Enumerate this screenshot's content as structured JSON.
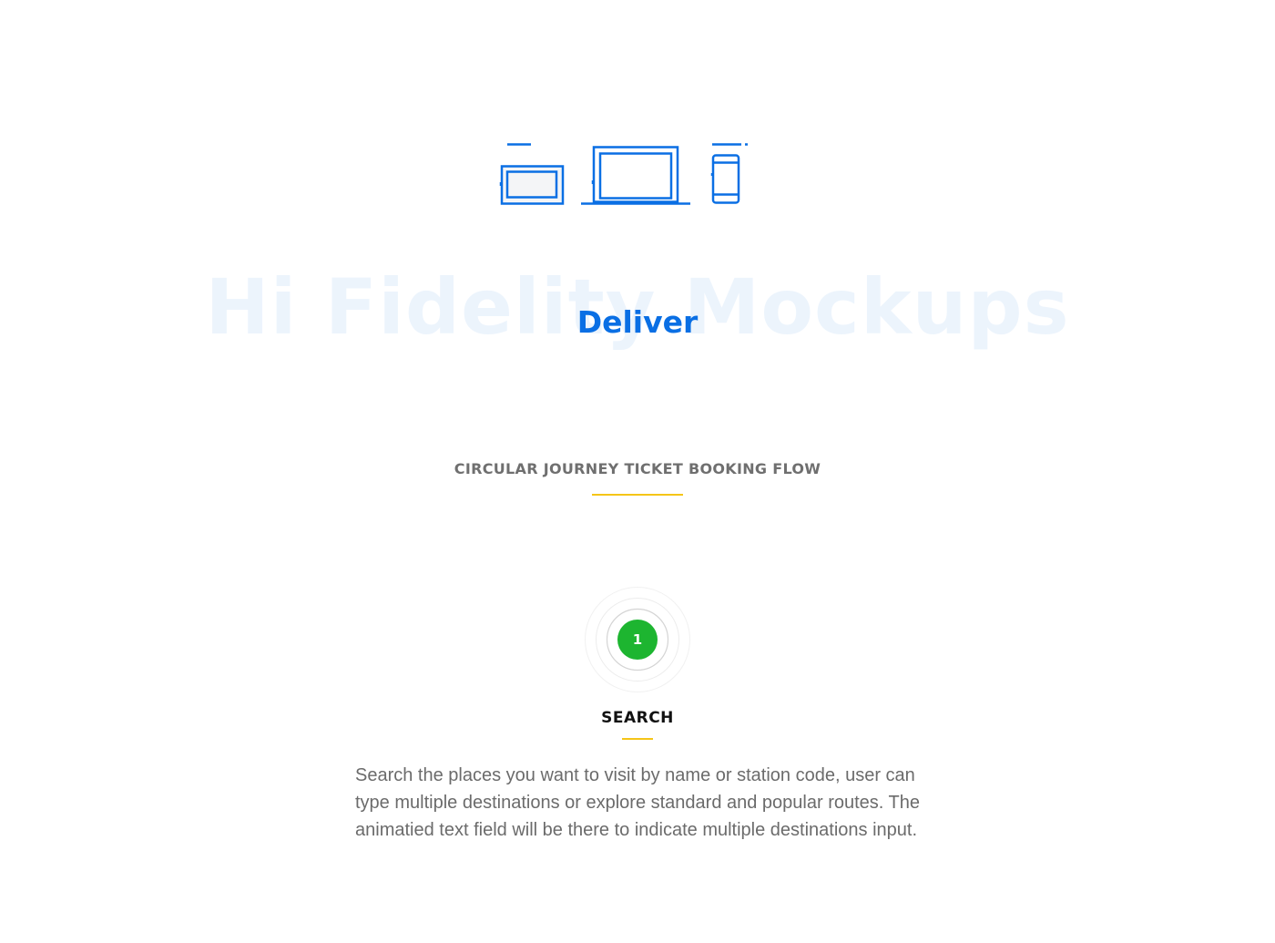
{
  "hero": {
    "background_title": "Hi Fidelity Mockups",
    "title": "Deliver",
    "icons": [
      "tablet-icon",
      "laptop-icon",
      "phone-icon"
    ]
  },
  "section": {
    "title": "CIRCULAR JOURNEY TICKET BOOKING FLOW"
  },
  "step": {
    "number": "1",
    "title": "SEARCH",
    "description": "Search the places you want to visit by name or station code, user can type multiple destinations or explore standard and popular routes. The animatied text field will be there to indicate multiple destinations input."
  },
  "colors": {
    "accent_blue": "#0a6fe4",
    "accent_yellow": "#f5c518",
    "step_green": "#1db530",
    "text_gray": "#6b6b6b"
  }
}
